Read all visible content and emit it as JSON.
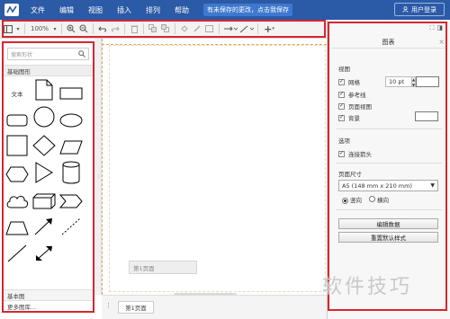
{
  "menubar": {
    "items": [
      "文件",
      "编辑",
      "视图",
      "插入",
      "排列",
      "帮助"
    ],
    "unsaved_notice": "有未保存的更改，点击我保存",
    "user_login": "用户登录"
  },
  "toolbar": {
    "zoom": "100%"
  },
  "sidebar": {
    "search_placeholder": "搜索形状",
    "section_basic": "基础图形",
    "text_shape_label": "文本",
    "foot_basic": "基本图",
    "foot_more": "更多图库..."
  },
  "canvas": {
    "page_tab_float": "第1页面"
  },
  "bottombar": {
    "page_tab": "第1页面"
  },
  "rightpanel": {
    "title": "图表",
    "view_heading": "视图",
    "grid_label": "网格",
    "grid_size": "10 pt",
    "guides_label": "参考线",
    "page_view_label": "页面视图",
    "background_label": "背景",
    "options_heading": "选项",
    "connection_arrows_label": "连接箭头",
    "page_size_heading": "页面尺寸",
    "page_size_value": "A5 (148 mm x 210 mm)",
    "portrait_label": "竖向",
    "landscape_label": "横向",
    "edit_data_button": "编辑数据",
    "reset_style_button": "重置默认样式"
  },
  "watermark": "软件技巧",
  "colors": {
    "menubar_bg": "#2b5aa6",
    "highlight_red": "#d7262e",
    "canvas_dash": "#e4a35a"
  }
}
